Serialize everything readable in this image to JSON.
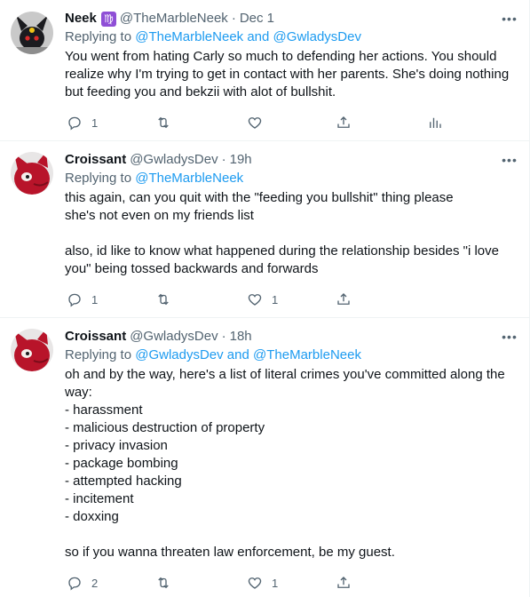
{
  "tweets": [
    {
      "name": "Neek",
      "badge": "♍",
      "handle": "@TheMarbleNeek",
      "sep": "·",
      "time": "Dec 1",
      "reply_prefix": "Replying to ",
      "reply_to_1": "@TheMarbleNeek",
      "reply_and": " and ",
      "reply_to_2": "@GwladysDev",
      "lines": [
        "You went from hating Carly so much to defending her actions. You should realize why I'm trying to get in contact with her parents. She's doing nothing but feeding you and bekzii with alot of bullshit."
      ],
      "reply_count": "1",
      "more": "•••"
    },
    {
      "name": "Croissant",
      "handle": "@GwladysDev",
      "sep": "·",
      "time": "19h",
      "reply_prefix": "Replying to ",
      "reply_to_1": "@TheMarbleNeek",
      "lines": [
        "this again, can you quit with the \"feeding you bullshit\" thing please",
        "she's not even on my friends list",
        "",
        "also, id like to know what happened during the relationship besides \"i love you\" being tossed backwards and forwards"
      ],
      "reply_count": "1",
      "like_count": "1",
      "more": "•••"
    },
    {
      "name": "Croissant",
      "handle": "@GwladysDev",
      "sep": "·",
      "time": "18h",
      "reply_prefix": "Replying to ",
      "reply_to_1": "@GwladysDev",
      "reply_and": " and ",
      "reply_to_2": "@TheMarbleNeek",
      "lines": [
        "oh and by the way, here's a list of literal crimes you've committed along the way:",
        "- harassment",
        "- malicious destruction of property",
        "- privacy invasion",
        "- package bombing",
        "- attempted hacking",
        "- incitement",
        "- doxxing",
        "",
        "so if you wanna threaten law enforcement, be my guest."
      ],
      "reply_count": "2",
      "like_count": "1",
      "more": "•••"
    }
  ],
  "colors": {
    "link": "#1d9bf0",
    "muted": "#536471",
    "text": "#0f1419",
    "badge": "#8f4fd6"
  },
  "icons": [
    "reply-icon",
    "retweet-icon",
    "like-icon",
    "share-icon",
    "analytics-icon",
    "more-icon"
  ]
}
